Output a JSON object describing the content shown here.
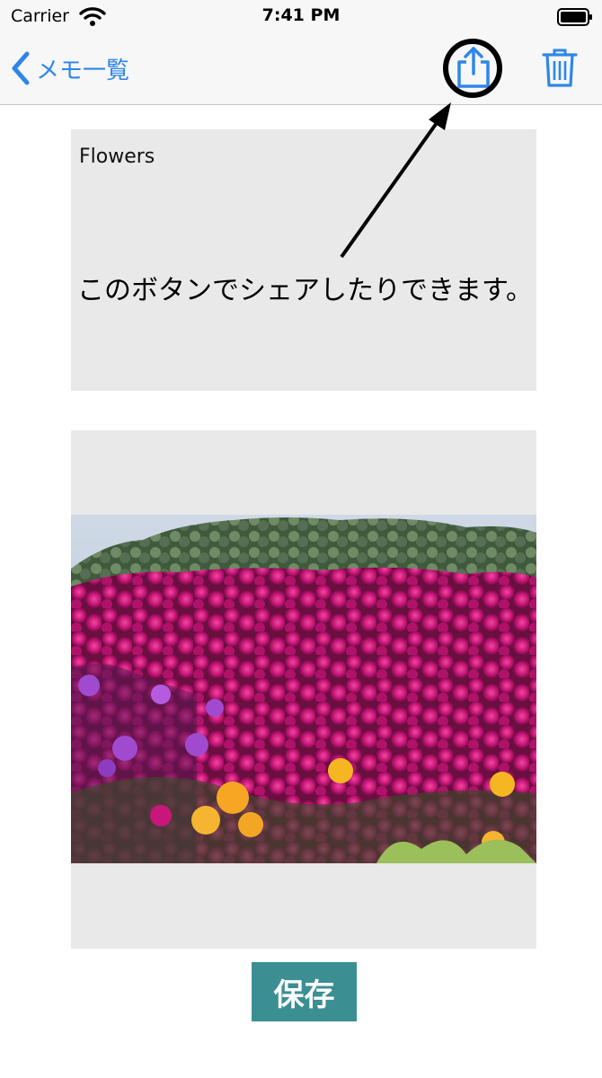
{
  "status_bar": {
    "carrier": "Carrier",
    "time": "7:41 PM"
  },
  "nav_bar": {
    "back_label": "メモ一覧"
  },
  "memo": {
    "text": "Flowers"
  },
  "annotation": {
    "caption": "このボタンでシェアしたりできます。"
  },
  "actions": {
    "save_label": "保存"
  },
  "icons": [
    "wifi-icon",
    "battery-icon",
    "chevron-left-icon",
    "share-icon",
    "trash-icon"
  ],
  "colors": {
    "accent": "#2f86e8",
    "save_button": "#3b8f93",
    "panel": "#e9e9e9",
    "bar": "#f7f7f7"
  }
}
